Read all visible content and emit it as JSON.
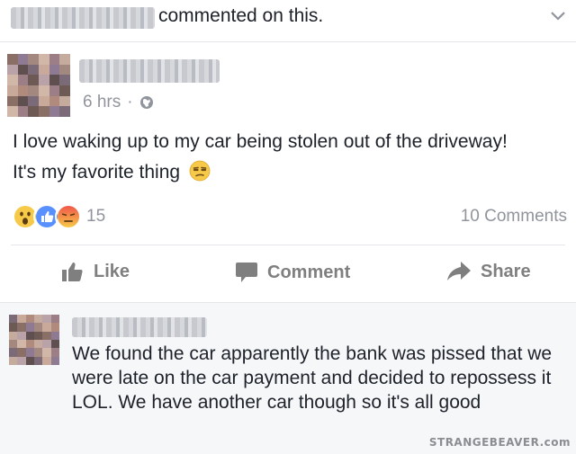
{
  "notification": {
    "text": "commented on this."
  },
  "post": {
    "author": "Brittany White",
    "time": "6 hrs",
    "separator": "·",
    "body_line1": "I love waking up to my car being stolen out of the driveway!",
    "body_line2": "It's my favorite thing",
    "reaction_count": "15",
    "comments_count": "10 Comments",
    "reaction_icons": [
      "wow-reaction-icon",
      "like-reaction-icon",
      "angry-reaction-icon"
    ]
  },
  "actions": {
    "like": "Like",
    "comment": "Comment",
    "share": "Share"
  },
  "comment": {
    "author": "Brittany White",
    "text": "We found the car apparently the bank was pissed that we were late on the car payment and decided to repossess it LOL. We have another car though so it's all good"
  },
  "watermark": "STRANGEBEAVER.com",
  "colors": {
    "meta_gray": "#90949c",
    "action_gray": "#7f7f7f",
    "comment_bg": "#f6f7f9",
    "like_blue": "#5890ff",
    "angry_red": "#f0564a",
    "wow_yellow": "#f7c948"
  }
}
